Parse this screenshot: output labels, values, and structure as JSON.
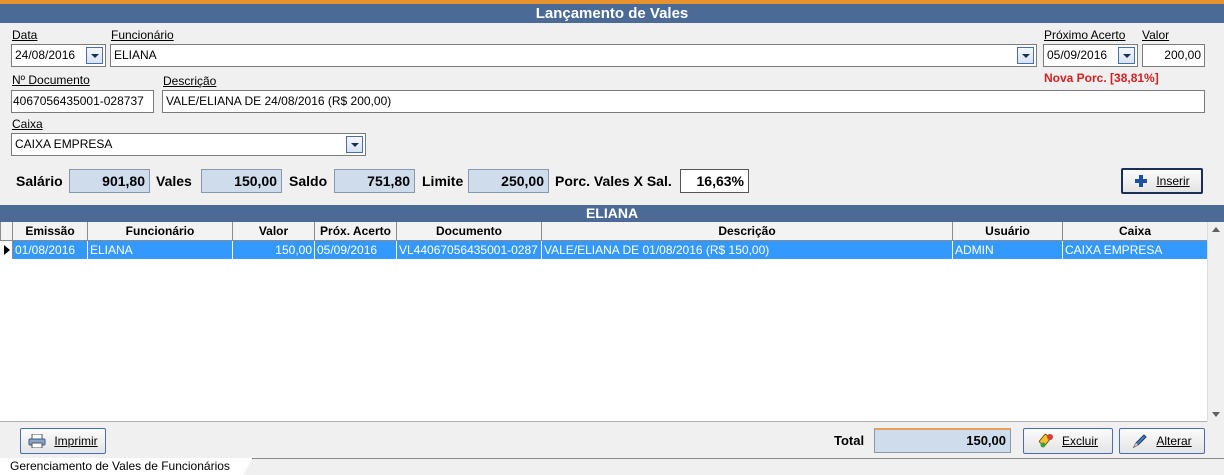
{
  "window": {
    "title": "Lançamento de Vales"
  },
  "form": {
    "data": {
      "label": "Data",
      "value": "24/08/2016"
    },
    "funcionario": {
      "label": "Funcionário",
      "value": "ELIANA"
    },
    "proximo_acerto": {
      "label": "Próximo Acerto",
      "value": "05/09/2016"
    },
    "valor": {
      "label": "Valor",
      "value": "200,00"
    },
    "nova_porc": "Nova Porc. [38,81%]",
    "documento": {
      "label": "Nº Documento",
      "value": "4067056435001-028737"
    },
    "descricao": {
      "label": "Descrição",
      "value": "VALE/ELIANA DE 24/08/2016 (R$ 200,00)"
    },
    "caixa": {
      "label": "Caixa",
      "value": "CAIXA EMPRESA"
    }
  },
  "summary": {
    "salario": {
      "label": "Salário",
      "value": "901,80"
    },
    "vales": {
      "label": "Vales",
      "value": "150,00"
    },
    "saldo": {
      "label": "Saldo",
      "value": "751,80"
    },
    "limite": {
      "label": "Limite",
      "value": "250,00"
    },
    "porc": {
      "label": "Porc. Vales X Sal.",
      "value": "16,63%"
    }
  },
  "buttons": {
    "inserir": "Inserir",
    "imprimir": "Imprimir",
    "excluir": "Excluir",
    "alterar": "Alterar"
  },
  "grid": {
    "title": "ELIANA",
    "columns": [
      "Emissão",
      "Funcionário",
      "Valor",
      "Próx. Acerto",
      "Documento",
      "Descrição",
      "Usuário",
      "Caixa"
    ],
    "rows": [
      [
        "01/08/2016",
        "ELIANA",
        "150,00",
        "05/09/2016",
        "VL44067056435001-0287",
        "VALE/ELIANA DE 01/08/2016 (R$ 150,00)",
        "ADMIN",
        "CAIXA EMPRESA"
      ]
    ]
  },
  "footer": {
    "total_label": "Total",
    "total_value": "150,00"
  },
  "tab": {
    "label": "Gerenciamento de Vales de Funcionários"
  },
  "colors": {
    "header_blue": "#4b6b96",
    "selection_blue": "#3399ff",
    "warning_red": "#d62020",
    "accent_orange": "#e8912f"
  }
}
